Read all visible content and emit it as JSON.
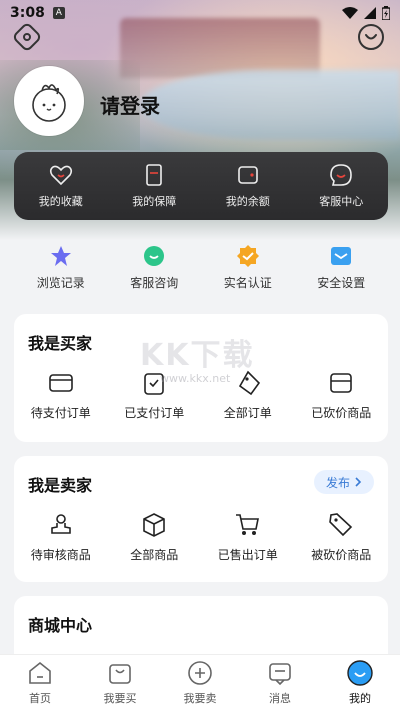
{
  "status": {
    "time": "3:08",
    "badge": "A"
  },
  "user": {
    "login_label": "请登录"
  },
  "dark_card": {
    "items": [
      {
        "label": "我的收藏"
      },
      {
        "label": "我的保障"
      },
      {
        "label": "我的余额"
      },
      {
        "label": "客服中心"
      }
    ]
  },
  "quick": {
    "items": [
      {
        "label": "浏览记录"
      },
      {
        "label": "客服咨询"
      },
      {
        "label": "实名认证"
      },
      {
        "label": "安全设置"
      }
    ]
  },
  "buyer": {
    "title": "我是买家",
    "items": [
      {
        "label": "待支付订单"
      },
      {
        "label": "已支付订单"
      },
      {
        "label": "全部订单"
      },
      {
        "label": "已砍价商品"
      }
    ]
  },
  "seller": {
    "title": "我是卖家",
    "publish_label": "发布",
    "items": [
      {
        "label": "待审核商品"
      },
      {
        "label": "全部商品"
      },
      {
        "label": "已售出订单"
      },
      {
        "label": "被砍价商品"
      }
    ]
  },
  "mall": {
    "title": "商城中心"
  },
  "watermark": {
    "text": "KK下载",
    "url": "www.kkx.net"
  },
  "bottom_nav": {
    "items": [
      {
        "label": "首页"
      },
      {
        "label": "我要买"
      },
      {
        "label": "我要卖"
      },
      {
        "label": "消息"
      },
      {
        "label": "我的"
      }
    ]
  },
  "colors": {
    "accent_blue": "#3a7bd5",
    "dark_card": "#2e2e30",
    "red_icon": "#e8453c"
  }
}
